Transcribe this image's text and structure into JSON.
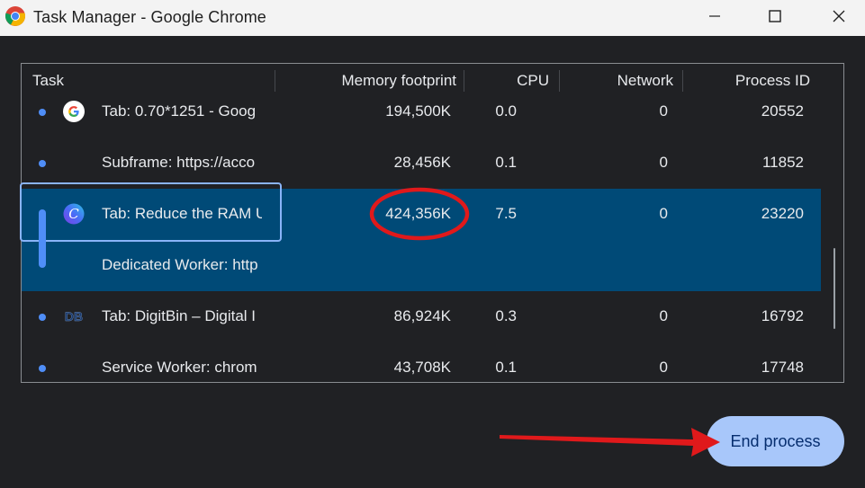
{
  "window": {
    "title": "Task Manager - Google Chrome",
    "controls": {
      "minimize": "minimize-icon",
      "maximize": "maximize-icon",
      "close": "close-icon"
    }
  },
  "table": {
    "columns": [
      "Task",
      "Memory footprint",
      "CPU",
      "Network",
      "Process ID"
    ],
    "rows": [
      {
        "icon": "google-favicon-icon",
        "task": "Tab: 0.70*1251 - Goog",
        "memory": "194,500K",
        "cpu": "0.0",
        "network": "0",
        "pid": "20552"
      },
      {
        "icon": "",
        "task": "Subframe: https://acco",
        "memory": "28,456K",
        "cpu": "0.1",
        "network": "0",
        "pid": "11852"
      },
      {
        "icon": "canva-favicon-icon",
        "task": "Tab: Reduce the RAM U",
        "memory": "424,356K",
        "cpu": "7.5",
        "network": "0",
        "pid": "23220",
        "selected": true
      },
      {
        "icon": "",
        "task": "Dedicated Worker: http",
        "memory": "",
        "cpu": "",
        "network": "",
        "pid": "",
        "selected": true,
        "child": true
      },
      {
        "icon": "digitbin-favicon-icon",
        "task": "Tab: DigitBin – Digital I",
        "memory": "86,924K",
        "cpu": "0.3",
        "network": "0",
        "pid": "16792"
      },
      {
        "icon": "",
        "task": "Service Worker: chrom",
        "memory": "43,708K",
        "cpu": "0.1",
        "network": "0",
        "pid": "17748"
      }
    ]
  },
  "favicon_text": {
    "digitbin": "DB"
  },
  "favicon_letter": {
    "canva": "C"
  },
  "actions": {
    "end_process": "End process"
  },
  "colors": {
    "accent": "#a8c7fa",
    "selection": "#004a77",
    "annotation": "#e0191b"
  }
}
